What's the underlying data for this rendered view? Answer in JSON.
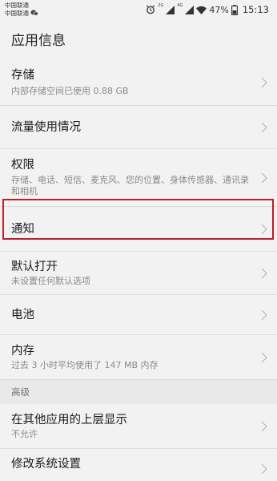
{
  "status_bar": {
    "carrier1": "中国联通",
    "carrier2": "中国联通",
    "net1": "2G",
    "net2": "4G",
    "battery": "47%",
    "time": "15:13"
  },
  "header": {
    "title": "应用信息"
  },
  "items": [
    {
      "title": "存储",
      "subtitle": "内部存储空间已使用 0.88 GB"
    },
    {
      "title": "流量使用情况"
    },
    {
      "title": "权限",
      "subtitle": "存储、电话、短信、麦克风、您的位置、身体传感器、通讯录和相机"
    },
    {
      "title": "通知"
    },
    {
      "title": "默认打开",
      "subtitle": "未设置任何默认选项"
    },
    {
      "title": "电池"
    },
    {
      "title": "内存",
      "subtitle": "过去 3 小时平均使用了 147 MB 内存"
    }
  ],
  "section": {
    "label": "高级"
  },
  "advanced": [
    {
      "title": "在其他应用的上层显示",
      "subtitle": "不允许"
    },
    {
      "title": "修改系统设置"
    }
  ]
}
